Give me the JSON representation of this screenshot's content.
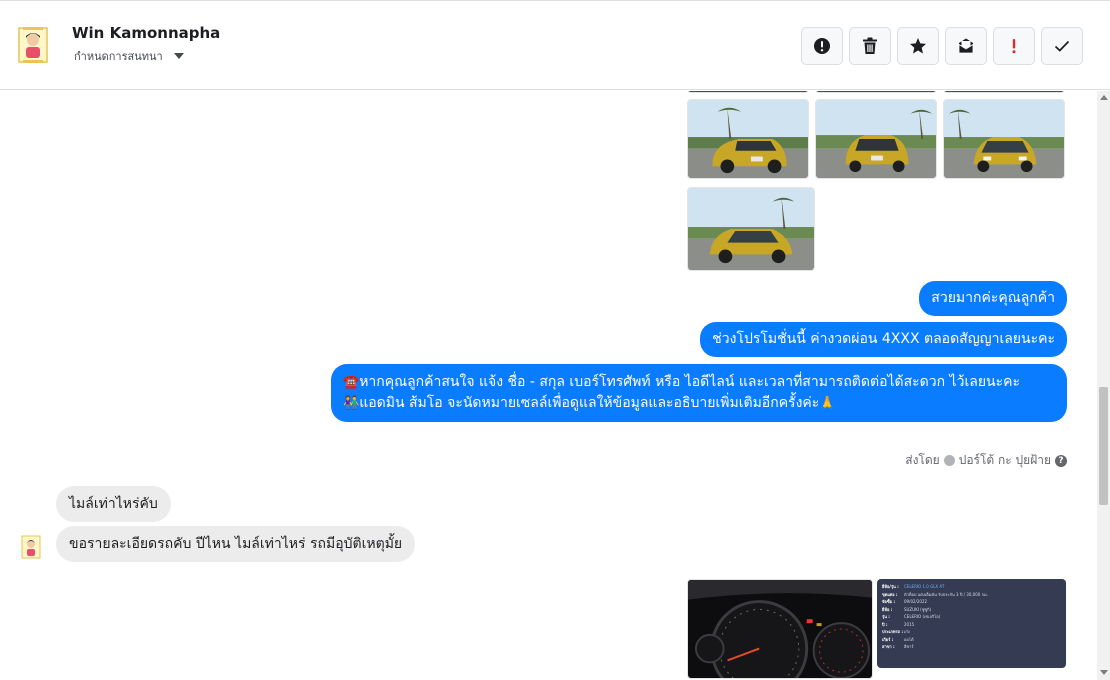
{
  "header": {
    "contact_name": "Win Kamonnapha",
    "assign_label": "กำหนดการสนทนา"
  },
  "toolbar": {
    "buttons": [
      {
        "name": "spam",
        "icon": "alert-circle-icon"
      },
      {
        "name": "delete",
        "icon": "trash-icon"
      },
      {
        "name": "star",
        "icon": "star-icon"
      },
      {
        "name": "mark-unread",
        "icon": "envelope-icon"
      },
      {
        "name": "follow-up",
        "icon": "exclamation-icon"
      },
      {
        "name": "done",
        "icon": "check-icon"
      }
    ]
  },
  "messages": {
    "out_1": "สวยมากค่ะคุณลูกค้า",
    "out_2": "ช่วงโปรโมชั่นนี้ ค่างวดผ่อน 4XXX ตลอดสัญญาเลยนะคะ",
    "out_3_line1": "หากคุณลูกค้าสนใจ แจ้ง ชื่อ - สกุล เบอร์โทรศัพท์ หรือ ไอดีไลน์ และเวลาที่สามารถติดต่อได้สะดวก ไว้เลยนะคะ",
    "out_3_line2": "แอดมิน ส้มโอ จะนัดหมายเซลล์เพื่อดูแลให้ข้อมูลและอธิบายเพิ่มเติมอีกครั้งค่ะ",
    "emoji_phone": "☎️",
    "emoji_people": "👫",
    "emoji_pray": "🙏",
    "sent_by_prefix": "ส่งโดย",
    "sent_by_name": "ปอร์โต้ กะ ปุยฝ้าย",
    "help_mark": "?",
    "in_1": "ไมล์เท่าไหร่คับ",
    "in_2": "ขอรายละเอียดรถคับ ปีไหน  ไมล์เท่าไหร่  รถมีอุบัติเหตุมั้ย"
  },
  "car_specs": {
    "rows": [
      {
        "k": "ยี่ห้อ/รุ่น :",
        "v": "CELERIO 1.0 GLX AT",
        "hl": true
      },
      {
        "k": "ชุดแต่ง :",
        "v": "ตัวท็อป แต่งเต็มคัน รับประกัน 3 ปี / 30,000 กม.",
        "hl": false
      },
      {
        "k": "จัดซื้อ :",
        "v": "09/02/2022",
        "hl": false
      },
      {
        "k": "ยี่ห้อ :",
        "v": "SUZUKI (ซูซูกิ)",
        "hl": false
      },
      {
        "k": "รุ่น :",
        "v": "CELERIO (เซเลริโอ)",
        "hl": false
      },
      {
        "k": "ปี :",
        "v": "2015",
        "hl": false
      },
      {
        "k": "ประเภทรถ :",
        "v": "เก๋ง",
        "hl": false
      },
      {
        "k": "เกียร์ :",
        "v": "ออโต้",
        "hl": false
      },
      {
        "k": "สาขา :",
        "v": "อีซาร์",
        "hl": false
      }
    ]
  }
}
